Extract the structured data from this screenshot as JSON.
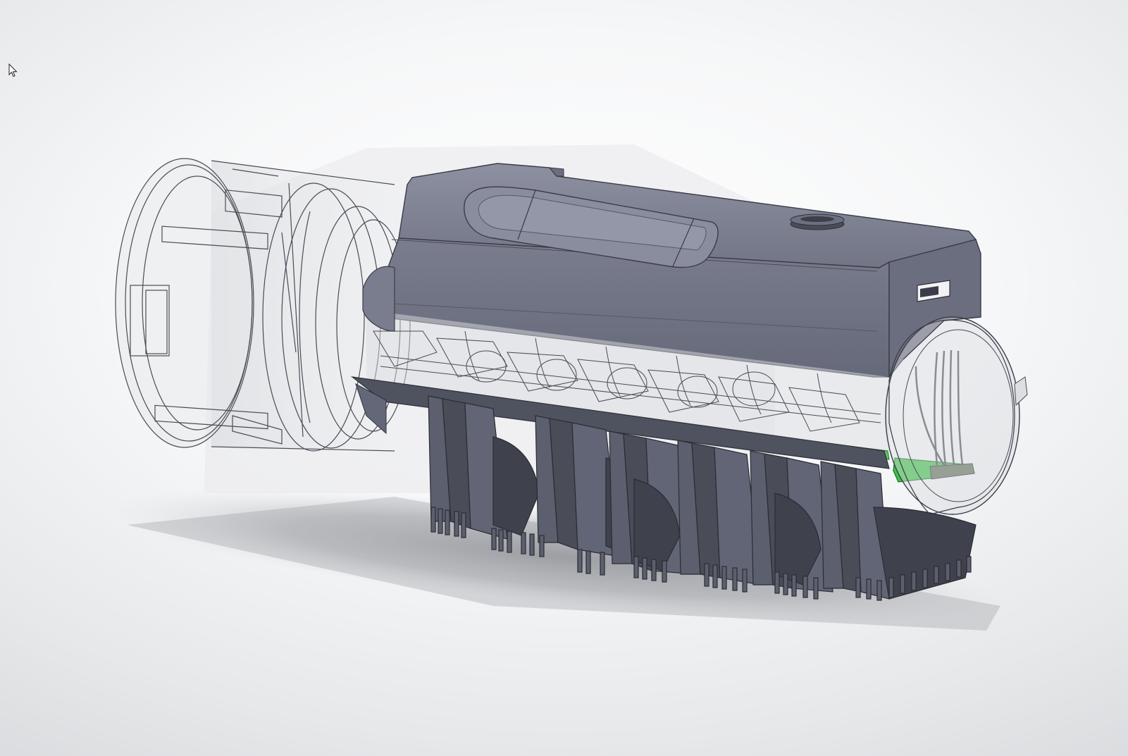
{
  "viewport": {
    "background_top": "#ffffff",
    "background_bottom": "#dcdde0"
  },
  "model": {
    "housing_color": "#7d8090",
    "housing_dark": "#5f6272",
    "housing_edge": "#3a3c47",
    "comb_color": "#5c5f6d",
    "comb_dark": "#3f414c",
    "pcb_color": "#3ec24a",
    "glass_edge": "#4a4c55",
    "shadow_color": "#9a9ca0"
  },
  "cursor": {
    "icon": "arrow-pointer-icon"
  }
}
